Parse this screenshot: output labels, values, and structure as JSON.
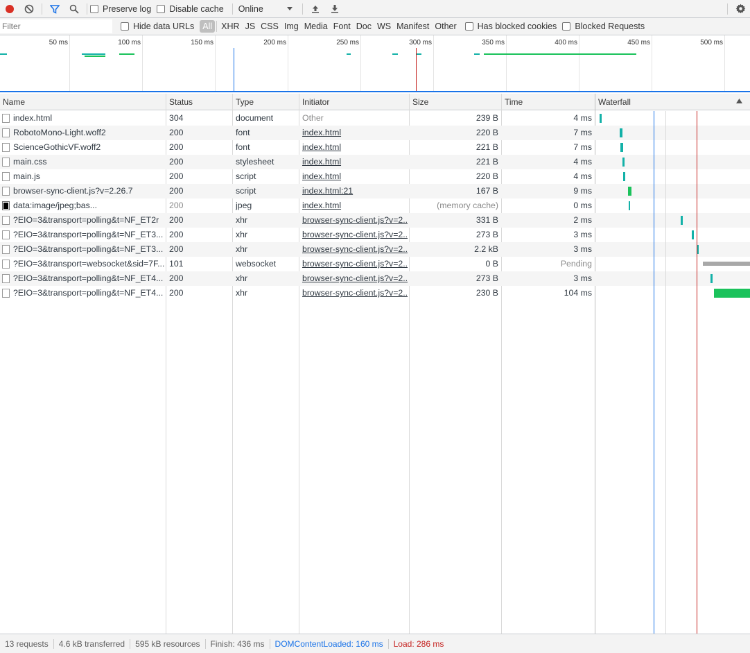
{
  "toolbar": {
    "preserve_log": "Preserve log",
    "disable_cache": "Disable cache",
    "throttle": "Online"
  },
  "filterbar": {
    "filter_placeholder": "Filter",
    "hide_data_urls": "Hide data URLs",
    "types": [
      "All",
      "XHR",
      "JS",
      "CSS",
      "Img",
      "Media",
      "Font",
      "Doc",
      "WS",
      "Manifest",
      "Other"
    ],
    "has_blocked_cookies": "Has blocked cookies",
    "blocked_requests": "Blocked Requests"
  },
  "overview": {
    "ticks": [
      "50 ms",
      "100 ms",
      "150 ms",
      "200 ms",
      "250 ms",
      "300 ms",
      "350 ms",
      "400 ms",
      "450 ms",
      "500 ms"
    ]
  },
  "columns": {
    "name": "Name",
    "status": "Status",
    "type": "Type",
    "initiator": "Initiator",
    "size": "Size",
    "time": "Time",
    "waterfall": "Waterfall"
  },
  "requests": [
    {
      "name": "index.html",
      "status": "304",
      "type": "document",
      "initiator": "Other",
      "size": "239 B",
      "time": "4 ms"
    },
    {
      "name": "RobotoMono-Light.woff2",
      "status": "200",
      "type": "font",
      "initiator": "index.html",
      "size": "220 B",
      "time": "7 ms"
    },
    {
      "name": "ScienceGothicVF.woff2",
      "status": "200",
      "type": "font",
      "initiator": "index.html",
      "size": "221 B",
      "time": "7 ms"
    },
    {
      "name": "main.css",
      "status": "200",
      "type": "stylesheet",
      "initiator": "index.html",
      "size": "221 B",
      "time": "4 ms"
    },
    {
      "name": "main.js",
      "status": "200",
      "type": "script",
      "initiator": "index.html",
      "size": "220 B",
      "time": "4 ms"
    },
    {
      "name": "browser-sync-client.js?v=2.26.7",
      "status": "200",
      "type": "script",
      "initiator": "index.html:21",
      "size": "167 B",
      "time": "9 ms"
    },
    {
      "name": "data:image/jpeg;bas...",
      "status": "200",
      "type": "jpeg",
      "initiator": "index.html",
      "size": "(memory cache)",
      "time": "0 ms"
    },
    {
      "name": "?EIO=3&transport=polling&t=NF_ET2r",
      "status": "200",
      "type": "xhr",
      "initiator": "browser-sync-client.js?v=2...",
      "size": "331 B",
      "time": "2 ms"
    },
    {
      "name": "?EIO=3&transport=polling&t=NF_ET3...",
      "status": "200",
      "type": "xhr",
      "initiator": "browser-sync-client.js?v=2...",
      "size": "273 B",
      "time": "3 ms"
    },
    {
      "name": "?EIO=3&transport=polling&t=NF_ET3...",
      "status": "200",
      "type": "xhr",
      "initiator": "browser-sync-client.js?v=2...",
      "size": "2.2 kB",
      "time": "3 ms"
    },
    {
      "name": "?EIO=3&transport=websocket&sid=7F...",
      "status": "101",
      "type": "websocket",
      "initiator": "browser-sync-client.js?v=2...",
      "size": "0 B",
      "time": "Pending"
    },
    {
      "name": "?EIO=3&transport=polling&t=NF_ET4...",
      "status": "200",
      "type": "xhr",
      "initiator": "browser-sync-client.js?v=2...",
      "size": "273 B",
      "time": "3 ms"
    },
    {
      "name": "?EIO=3&transport=polling&t=NF_ET4...",
      "status": "200",
      "type": "xhr",
      "initiator": "browser-sync-client.js?v=2...",
      "size": "230 B",
      "time": "104 ms"
    }
  ],
  "status": {
    "requests": "13 requests",
    "transferred": "4.6 kB transferred",
    "resources": "595 kB resources",
    "finish": "Finish: 436 ms",
    "dom_content_loaded": "DOMContentLoaded: 160 ms",
    "load": "Load: 286 ms"
  },
  "colors": {
    "record": "#d93025",
    "filter_active": "#1a73e8",
    "dom_content_loaded": "#1a73e8",
    "load": "#c5221f",
    "waiting_bar": "#13b1a8",
    "content_bar": "#1bc25b",
    "pending_bar": "#a8a8a8"
  }
}
